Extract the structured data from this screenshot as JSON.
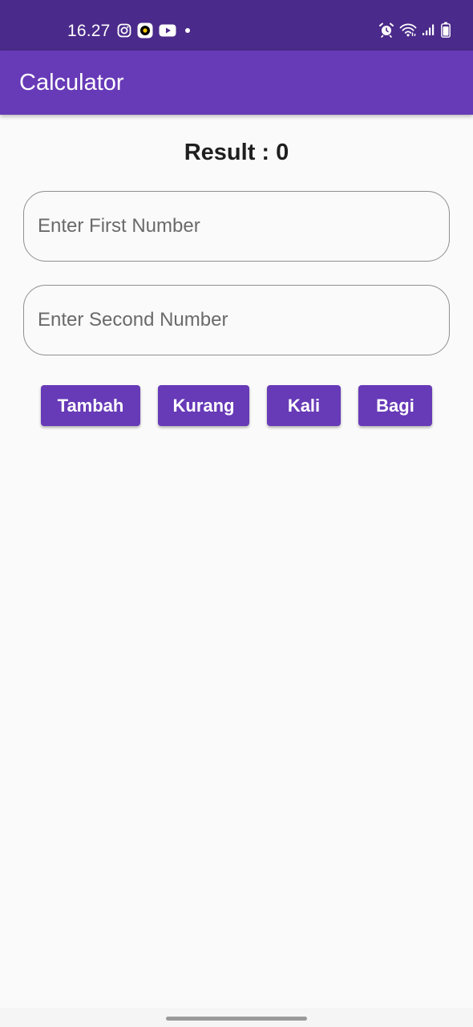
{
  "status_bar": {
    "time": "16.27",
    "left_icons": [
      "instagram-icon",
      "music-app-icon",
      "youtube-icon",
      "notification-dot-icon"
    ],
    "right_icons": [
      "alarm-icon",
      "wifi-icon",
      "signal-icon",
      "battery-icon"
    ],
    "background": "#4a2a8a"
  },
  "app_bar": {
    "title": "Calculator",
    "background": "#673ab7"
  },
  "result": {
    "text": "Result : 0"
  },
  "inputs": {
    "first_placeholder": "Enter First Number",
    "first_value": "",
    "second_placeholder": "Enter Second Number",
    "second_value": ""
  },
  "buttons": {
    "add": "Tambah",
    "subtract": "Kurang",
    "multiply": "Kali",
    "divide": "Bagi"
  },
  "colors": {
    "accent": "#673ab7",
    "background": "#fafafa",
    "button_text": "#ffffff"
  }
}
